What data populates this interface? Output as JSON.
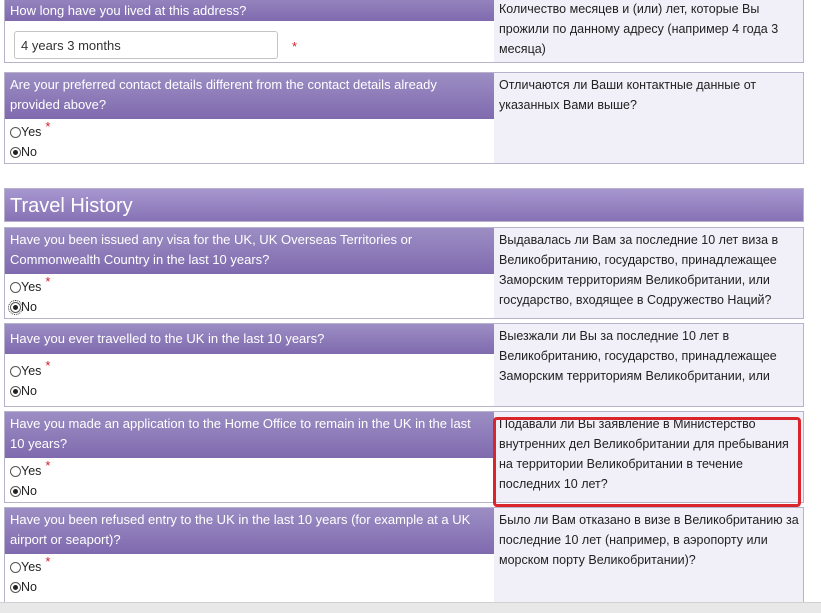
{
  "address_duration": {
    "question": "How long have you lived at this address?",
    "value": "4 years 3 months",
    "required_marker": "*",
    "translation": "Количество месяцев и (или) лет, которые Вы прожили по данному адресу (например 4 года 3 месяца)"
  },
  "contact_details": {
    "question": "Are your preferred contact details different from the contact details already provided above?",
    "translation": "Отличаются ли Ваши контактные данные от указанных Вами выше?",
    "yes_label": "Yes",
    "no_label": "No",
    "required_marker": "*"
  },
  "travel_history": {
    "title": "Travel History",
    "questions": [
      {
        "question": "Have you been issued any visa for the UK, UK Overseas Territories or Commonwealth Country in the last 10 years?",
        "translation": "Выдавалась ли Вам за последние 10 лет виза в Великобританию, государство, принадлежащее Заморским территориям Великобритании, или государство, входящее в Содружество Наций?",
        "yes_label": "Yes",
        "no_label": "No",
        "required_marker": "*"
      },
      {
        "question": "Have you ever travelled to the UK in the last 10 years?",
        "translation": "Выезжали ли Вы за последние 10 лет в Великобританию, государство, принадлежащее Заморским территориям Великобритании, или",
        "yes_label": "Yes",
        "no_label": "No",
        "required_marker": "*"
      },
      {
        "question": "Have you made an application to the Home Office to remain in the UK in the last 10 years?",
        "translation": "Подавали ли Вы заявление в Министерство внутренних дел Великобритании для пребывания на территории Великобритании в течение последних 10 лет?",
        "yes_label": "Yes",
        "no_label": "No",
        "required_marker": "*"
      },
      {
        "question": "Have you been refused entry to the UK in the last 10 years (for example at a UK airport or seaport)?",
        "translation": "Было ли Вам отказано в визе в Великобританию за последние 10 лет (например, в аэропорту или морском порту Великобритании)?",
        "yes_label": "Yes",
        "no_label": "No",
        "required_marker": "*"
      }
    ]
  },
  "colors": {
    "header_purple": "#8672b5",
    "translation_bg": "#f1f0f8",
    "required_red": "#d0202b",
    "highlight_red": "#d8262c"
  }
}
